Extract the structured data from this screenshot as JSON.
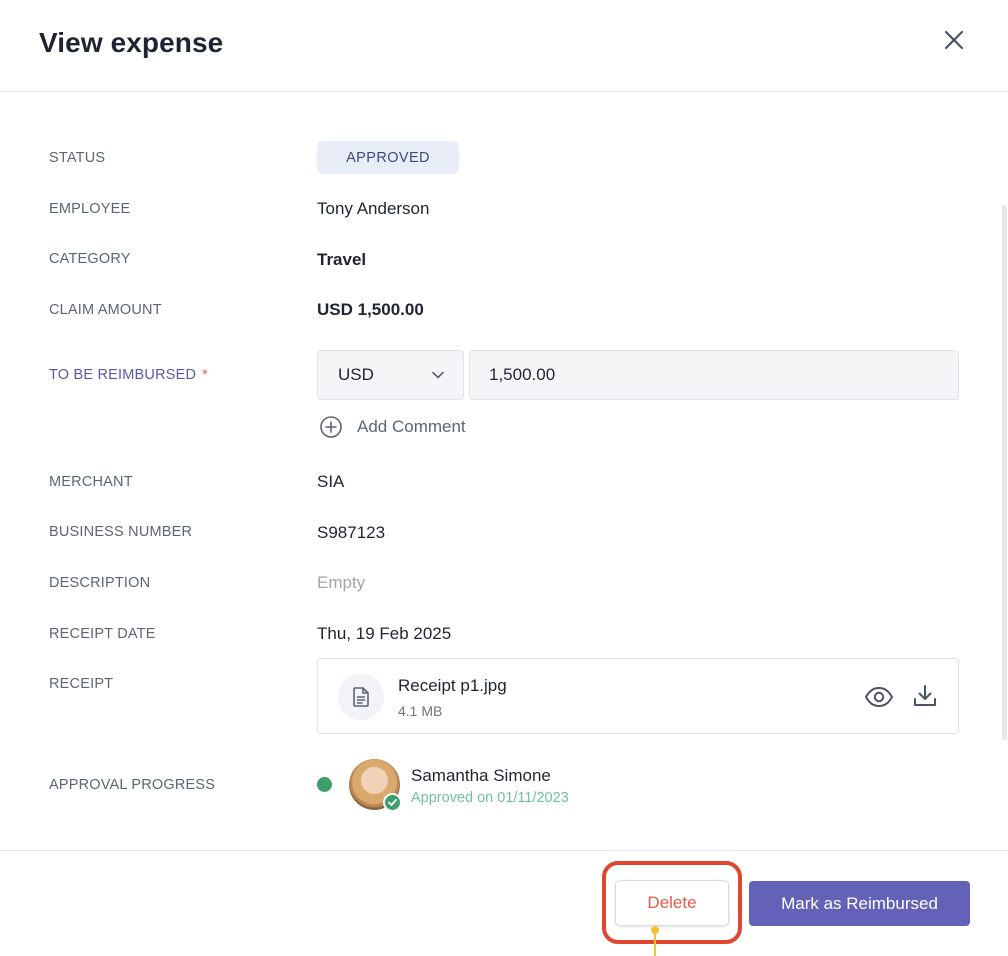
{
  "header": {
    "title": "View expense"
  },
  "fields": {
    "status": {
      "label": "STATUS",
      "value": "APPROVED"
    },
    "employee": {
      "label": "EMPLOYEE",
      "value": "Tony Anderson"
    },
    "category": {
      "label": "CATEGORY",
      "value": "Travel"
    },
    "claim_amount": {
      "label": "CLAIM AMOUNT",
      "value": "USD 1,500.00"
    },
    "to_be_reimbursed": {
      "label": "TO BE REIMBURSED",
      "required_marker": "*",
      "currency": "USD",
      "amount": "1,500.00"
    },
    "add_comment": "Add Comment",
    "merchant": {
      "label": "MERCHANT",
      "value": "SIA"
    },
    "business_number": {
      "label": "BUSINESS NUMBER",
      "value": "S987123"
    },
    "description": {
      "label": "DESCRIPTION",
      "value": "Empty"
    },
    "receipt_date": {
      "label": "RECEIPT DATE",
      "value": "Thu, 19 Feb 2025"
    },
    "receipt": {
      "label": "RECEIPT",
      "file_name": "Receipt p1.jpg",
      "file_size": "4.1 MB"
    },
    "approval_progress": {
      "label": "APPROVAL PROGRESS",
      "approver_name": "Samantha Simone",
      "approver_status": "Approved on 01/11/2023"
    }
  },
  "footer": {
    "delete_label": "Delete",
    "primary_label": "Mark as Reimbursed"
  },
  "colors": {
    "primary": "#6461b8",
    "danger": "#e45a4c",
    "success": "#3e9e6a",
    "highlight": "#e2452f",
    "pointer": "#f2c331"
  },
  "icons": [
    "close-icon",
    "chevron-down-icon",
    "plus-circle-icon",
    "file-icon",
    "eye-icon",
    "download-icon",
    "check-icon"
  ]
}
